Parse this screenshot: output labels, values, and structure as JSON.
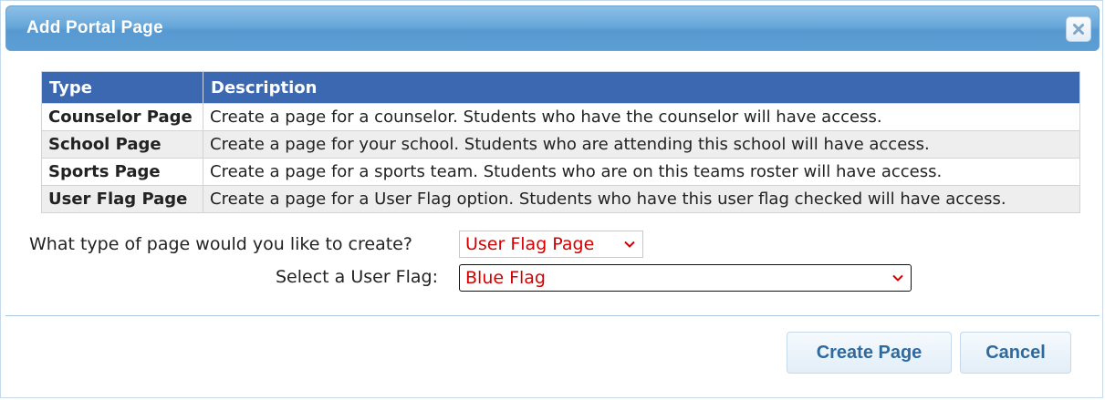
{
  "dialog": {
    "title": "Add Portal Page",
    "close_icon": "close-icon"
  },
  "table": {
    "headers": [
      "Type",
      "Description"
    ],
    "rows": [
      {
        "type": "Counselor Page",
        "description": "Create a page for a counselor. Students who have the counselor will have access."
      },
      {
        "type": "School Page",
        "description": "Create a page for your school. Students who are attending this school will have access."
      },
      {
        "type": "Sports Page",
        "description": "Create a page for a sports team. Students who are on this teams roster will have access."
      },
      {
        "type": "User Flag Page",
        "description": "Create a page for a User Flag option. Students who have this user flag checked will have access."
      }
    ],
    "header_color": "#3b68b1"
  },
  "form": {
    "page_type_label": "What type of page would you like to create?",
    "page_type_value": "User Flag Page",
    "user_flag_label": "Select a User Flag:",
    "user_flag_value": "Blue Flag",
    "value_color": "#d40000"
  },
  "buttons": {
    "create": "Create Page",
    "cancel": "Cancel"
  }
}
